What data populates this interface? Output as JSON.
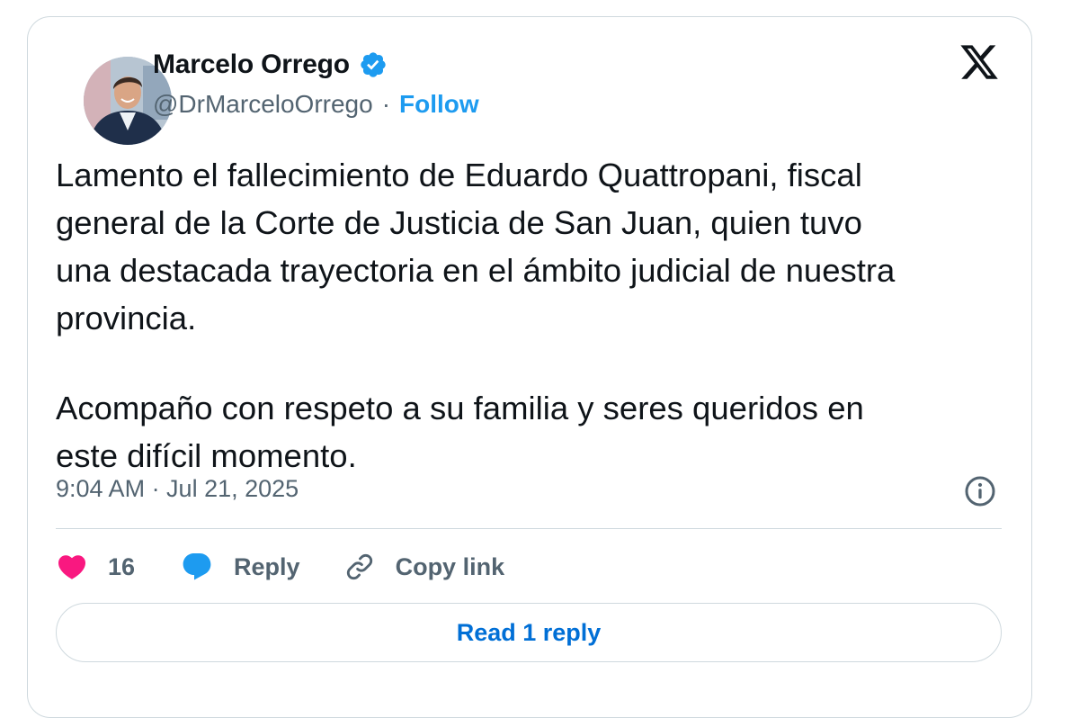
{
  "author": {
    "display_name": "Marcelo Orrego",
    "handle": "@DrMarceloOrrego",
    "separator": "·",
    "follow_label": "Follow",
    "verified": true
  },
  "tweet": {
    "paragraphs": [
      [
        "Lamento el fallecimiento de Eduardo Quattropani, fiscal",
        "general de la Corte de Justicia de San Juan, quien tuvo",
        "una destacada trayectoria en el ámbito judicial de nuestra",
        "provincia."
      ],
      [
        "Acompaño con respeto a su familia y seres queridos en",
        "este difícil momento."
      ]
    ],
    "timestamp": "9:04 AM · Jul 21, 2025"
  },
  "actions": {
    "like_count": "16",
    "reply_label": "Reply",
    "copy_link_label": "Copy link"
  },
  "read_replies_label": "Read 1 reply",
  "icons": {
    "logo": "x-logo-icon",
    "verified": "verified-badge-icon",
    "info": "info-icon",
    "like": "heart-icon",
    "reply": "speech-bubble-icon",
    "copy": "link-icon"
  },
  "colors": {
    "accent": "#1d9bf0",
    "like": "#f91880",
    "link_text": "#006fd6",
    "muted": "#536471",
    "border": "#cfd9de"
  }
}
